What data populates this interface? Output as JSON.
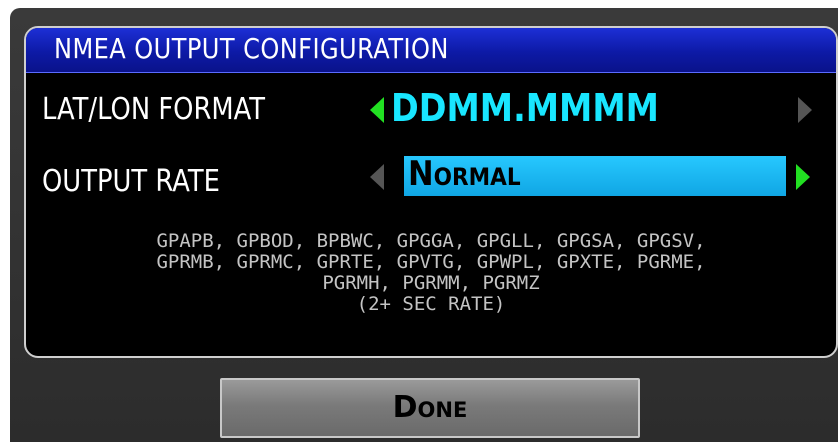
{
  "dialog": {
    "title": "NMEA OUTPUT CONFIGURATION"
  },
  "settings": [
    {
      "label": "LAT/LON FORMAT",
      "value": "DDMM.MMMM"
    },
    {
      "label": "OUTPUT RATE",
      "value": "Normal"
    }
  ],
  "sentences": {
    "line1": "GPAPB, GPBOD, BPBWC, GPGGA, GPGLL, GPGSA, GPGSV,",
    "line2": "GPRMB, GPRMC, GPRTE, GPVTG, GPWPL, GPXTE, PGRME,",
    "line3": "PGRMH, PGRMM, PGRMZ",
    "line4": "(2+ SEC RATE)"
  },
  "buttons": {
    "done_label": "Done"
  },
  "colors": {
    "title_bar": "#1128c8",
    "value_cyan": "#19e6ff",
    "selection": "#1cb8f2",
    "active_arrow": "#22e022",
    "inactive_arrow": "#555555"
  }
}
